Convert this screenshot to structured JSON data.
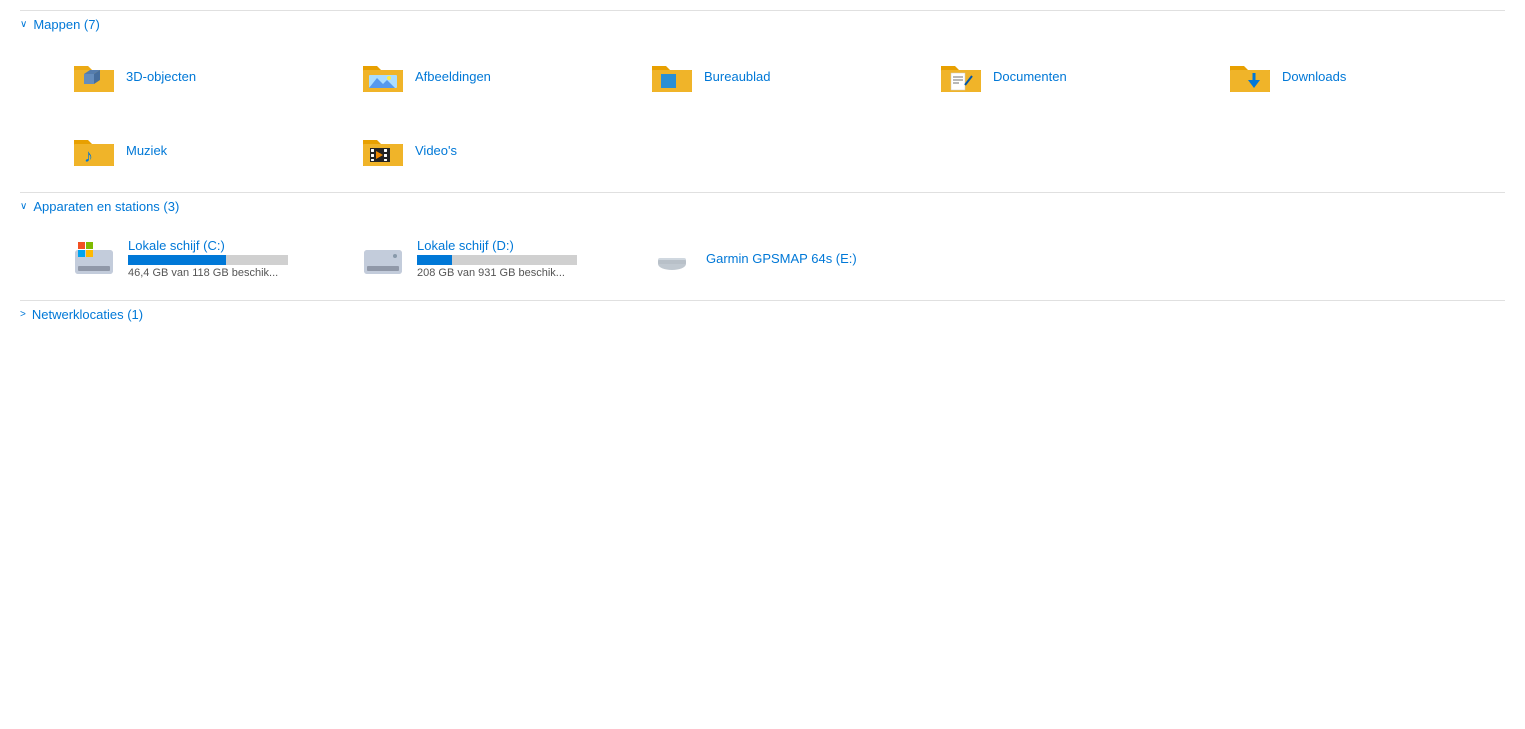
{
  "sections": {
    "folders": {
      "label": "Mappen (7)",
      "expanded": true,
      "items": [
        {
          "id": "3d-objecten",
          "name": "3D-objecten",
          "icon": "folder-3d"
        },
        {
          "id": "afbeeldingen",
          "name": "Afbeeldingen",
          "icon": "folder-pictures"
        },
        {
          "id": "bureaublad",
          "name": "Bureaublad",
          "icon": "folder-desktop"
        },
        {
          "id": "documenten",
          "name": "Documenten",
          "icon": "folder-documents"
        },
        {
          "id": "downloads",
          "name": "Downloads",
          "icon": "folder-downloads"
        },
        {
          "id": "muziek",
          "name": "Muziek",
          "icon": "folder-music"
        },
        {
          "id": "videos",
          "name": "Video's",
          "icon": "folder-videos"
        }
      ]
    },
    "devices": {
      "label": "Apparaten en stations (3)",
      "expanded": true,
      "items": [
        {
          "id": "c-drive",
          "name": "Lokale schijf (C:)",
          "size_info": "46,4 GB van 118 GB beschik...",
          "bar_fill": 0.61,
          "bar_color": "blue",
          "icon": "hdd-windows"
        },
        {
          "id": "d-drive",
          "name": "Lokale schijf (D:)",
          "size_info": "208 GB van 931 GB beschik...",
          "bar_fill": 0.22,
          "bar_color": "blue",
          "icon": "hdd-plain"
        },
        {
          "id": "e-drive",
          "name": "Garmin GPSMAP 64s (E:)",
          "size_info": "",
          "bar_fill": 0,
          "bar_color": "none",
          "icon": "usb-drive"
        }
      ]
    },
    "network": {
      "label": "Netwerklocaties (1)",
      "expanded": false
    }
  }
}
